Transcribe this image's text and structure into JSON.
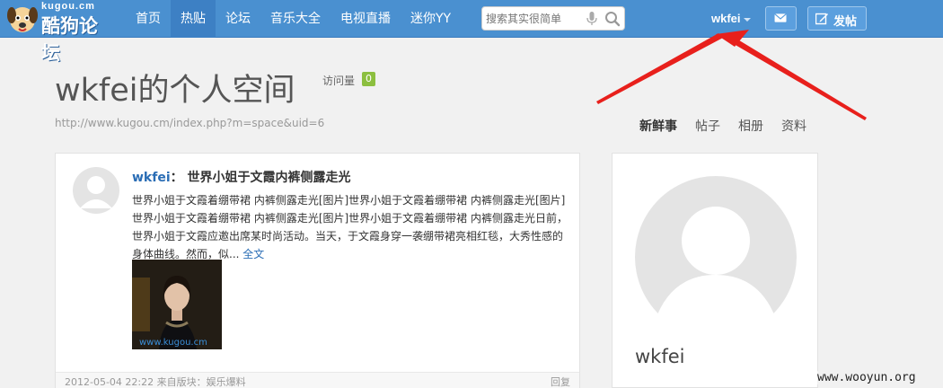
{
  "logo": {
    "site": "kugou.cm",
    "name": "酷狗论坛"
  },
  "nav": {
    "items": [
      "首页",
      "热贴",
      "论坛",
      "音乐大全",
      "电视直播",
      "迷你YY"
    ],
    "active_index": 1
  },
  "search": {
    "placeholder": "搜索其实很简单"
  },
  "user_menu": {
    "username": "wkfei"
  },
  "actions": {
    "post_label": "发帖"
  },
  "profile_header": {
    "title": "wkfei的个人空间",
    "visits_label": "访问量",
    "visits_count": "0",
    "url": "http://www.kugou.cm/index.php?m=space&uid=6",
    "tabs": [
      "新鲜事",
      "帖子",
      "相册",
      "资料"
    ],
    "active_tab": 0
  },
  "feed": {
    "author": "wkfei",
    "separator": "：",
    "title": "世界小姐于文霞内裤侧露走光",
    "body": "世界小姐于文霞着绷带裙 内裤侧露走光[图片]世界小姐于文霞着绷带裙 内裤侧露走光[图片]世界小姐于文霞着绷带裙 内裤侧露走光[图片]世界小姐于文霞着绷带裙 内裤侧露走光日前，世界小姐于文霞应邀出席某时尚活动。当天，于文霞身穿一袭绷带裙亮相红毯，大秀性感的身体曲线。然而，似...",
    "read_more": "全文",
    "image_watermark": "www.kugou.cm",
    "footer": "2012-05-04 22:22  来自版块：娱乐爆料",
    "reply": "回复"
  },
  "profile_card": {
    "name": "wkfei"
  },
  "watermark": "www.wooyun.org",
  "colors": {
    "topbar": "#4a90d0",
    "accent_link": "#2a6db5",
    "badge": "#8cbf3f",
    "arrow": "#e8201c"
  }
}
